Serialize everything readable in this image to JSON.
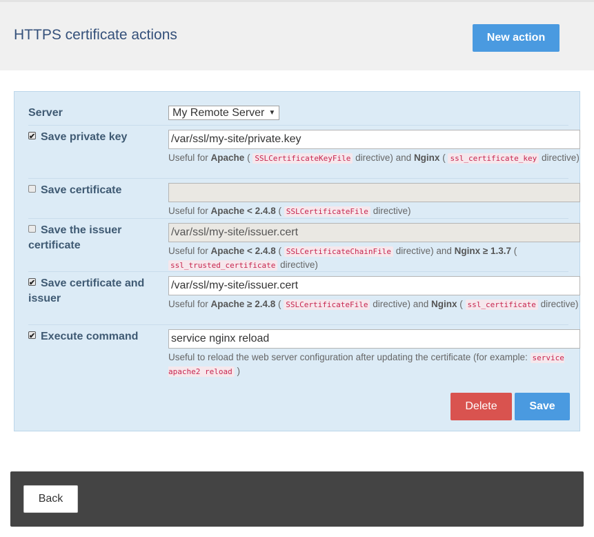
{
  "header": {
    "title": "HTTPS certificate actions",
    "new_action_label": "New action"
  },
  "form": {
    "server": {
      "label": "Server",
      "selected": "My Remote Server"
    },
    "rows": [
      {
        "label": "Save private key",
        "checked": true,
        "value": "/var/ssl/my-site/private.key",
        "help_html": "Useful for <b>Apache</b> ( <code>SSLCertificateKeyFile</code> directive) and <b>Nginx</b> ( <code>ssl_certificate_key</code> directive)"
      },
      {
        "label": "Save certificate",
        "checked": false,
        "value": "",
        "help_html": "Useful for <b>Apache &lt; 2.4.8</b> ( <code>SSLCertificateFile</code> directive)"
      },
      {
        "label": "Save the issuer certificate",
        "checked": false,
        "value": "/var/ssl/my-site/issuer.cert",
        "help_html": "Useful for <b>Apache &lt; 2.4.8</b> ( <code>SSLCertificateChainFile</code> directive) and <b>Nginx ≥ 1.3.7</b> ( <code>ssl_trusted_certificate</code> directive)"
      },
      {
        "label": "Save certificate and issuer",
        "checked": true,
        "value": "/var/ssl/my-site/issuer.cert",
        "help_html": "Useful for <b>Apache ≥ 2.4.8</b> ( <code>SSLCertificateFile</code> directive) and <b>Nginx</b> ( <code>ssl_certificate</code> directive)"
      },
      {
        "label": "Execute command",
        "checked": true,
        "value": "service nginx reload",
        "help_html": "Useful to reload the web server configuration after updating the certificate (for example: <code>service apache2 reload</code> )"
      }
    ],
    "delete_label": "Delete",
    "save_label": "Save"
  },
  "footer": {
    "back_label": "Back"
  },
  "colors": {
    "primary": "#4a9ae0",
    "danger": "#d9534f",
    "panel_bg": "#dcebf6",
    "footer_bg": "#444444"
  }
}
